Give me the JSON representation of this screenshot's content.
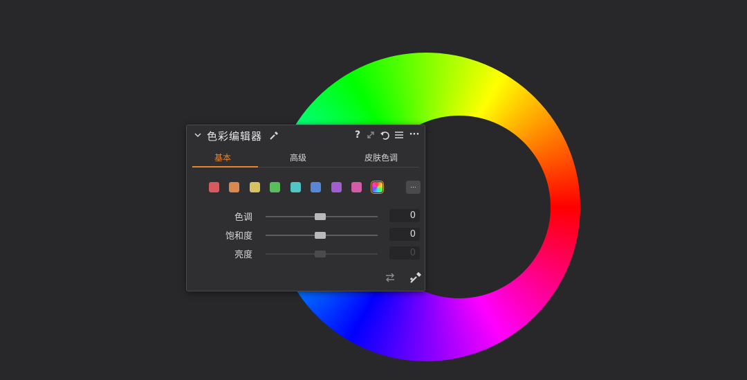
{
  "panel": {
    "title": "色彩编辑器",
    "header_icons": {
      "collapse": "chevron-down-icon",
      "picker": "eyedropper-icon",
      "help": "?",
      "expand": "expand-icon",
      "reset": "reset-icon",
      "menu": "menu-icon",
      "more": "···"
    },
    "tabs": [
      {
        "label": "基本",
        "active": true
      },
      {
        "label": "高级",
        "active": false
      },
      {
        "label": "皮肤色调",
        "active": false
      }
    ],
    "swatches": {
      "colors": [
        "#d65b5f",
        "#d98950",
        "#d6c260",
        "#5cbd5c",
        "#52c6c4",
        "#5a86d8",
        "#a05ed0",
        "#d25ca8"
      ],
      "all_colors_icon": "color-wheel-icon",
      "more_label": "..."
    },
    "sliders": [
      {
        "label": "色调",
        "value": "0",
        "level": 0.5,
        "enabled": true
      },
      {
        "label": "饱和度",
        "value": "0",
        "level": 0.5,
        "enabled": true
      },
      {
        "label": "亮度",
        "value": "0",
        "level": 0.5,
        "enabled": false
      }
    ],
    "footer_icons": [
      "swap-icon",
      "eyedropper-plus-icon"
    ]
  },
  "colors": {
    "background": "#28282a",
    "panel": "#2f2f31",
    "accent": "#e8862e"
  }
}
